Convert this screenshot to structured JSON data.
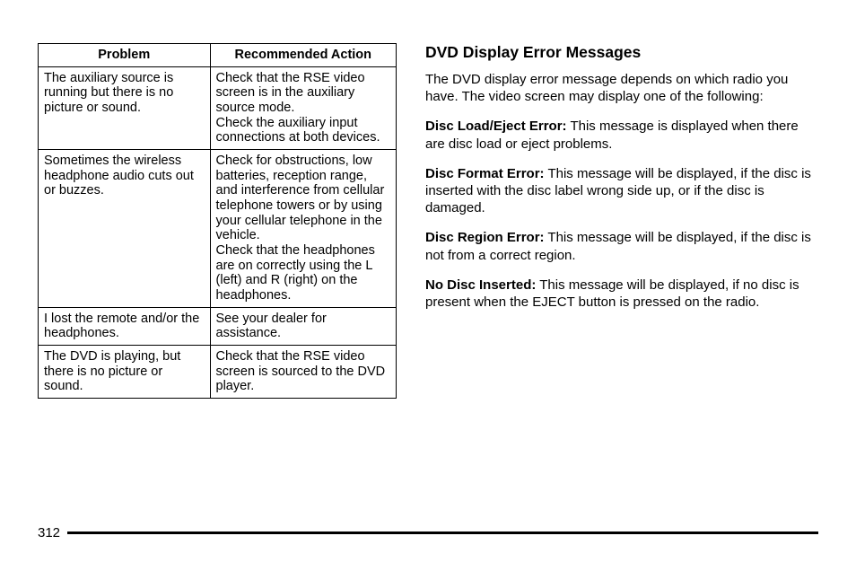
{
  "table": {
    "header": {
      "col1": "Problem",
      "col2": "Recommended Action"
    },
    "rows": [
      {
        "problem": "The auxiliary source is running but there is no picture or sound.",
        "action": "Check that the RSE video screen is in the auxiliary source mode.\nCheck the auxiliary input connections at both devices."
      },
      {
        "problem": "Sometimes the wireless headphone audio cuts out or buzzes.",
        "action": "Check for obstructions, low batteries, reception range, and interference from cellular telephone towers or by using your cellular telephone in the vehicle.\nCheck that the headphones are on correctly using the L (left) and R (right) on the headphones."
      },
      {
        "problem": "I lost the remote and/or the headphones.",
        "action": "See your dealer for assistance."
      },
      {
        "problem": "The DVD is playing, but there is no picture or sound.",
        "action": "Check that the RSE video screen is sourced to the DVD player."
      }
    ]
  },
  "right": {
    "heading": "DVD Display Error Messages",
    "intro": "The DVD display error message depends on which radio you have. The video screen may display one of the following:",
    "items": [
      {
        "term": "Disc Load/Eject Error:",
        "desc": " This message is displayed when there are disc load or eject problems."
      },
      {
        "term": "Disc Format Error:",
        "desc": " This message will be displayed, if the disc is inserted with the disc label wrong side up, or if the disc is damaged."
      },
      {
        "term": "Disc Region Error:",
        "desc": " This message will be displayed, if the disc is not from a correct region."
      },
      {
        "term": "No Disc Inserted:",
        "desc": " This message will be displayed, if no disc is present when the EJECT button is pressed on the radio."
      }
    ]
  },
  "page_number": "312"
}
